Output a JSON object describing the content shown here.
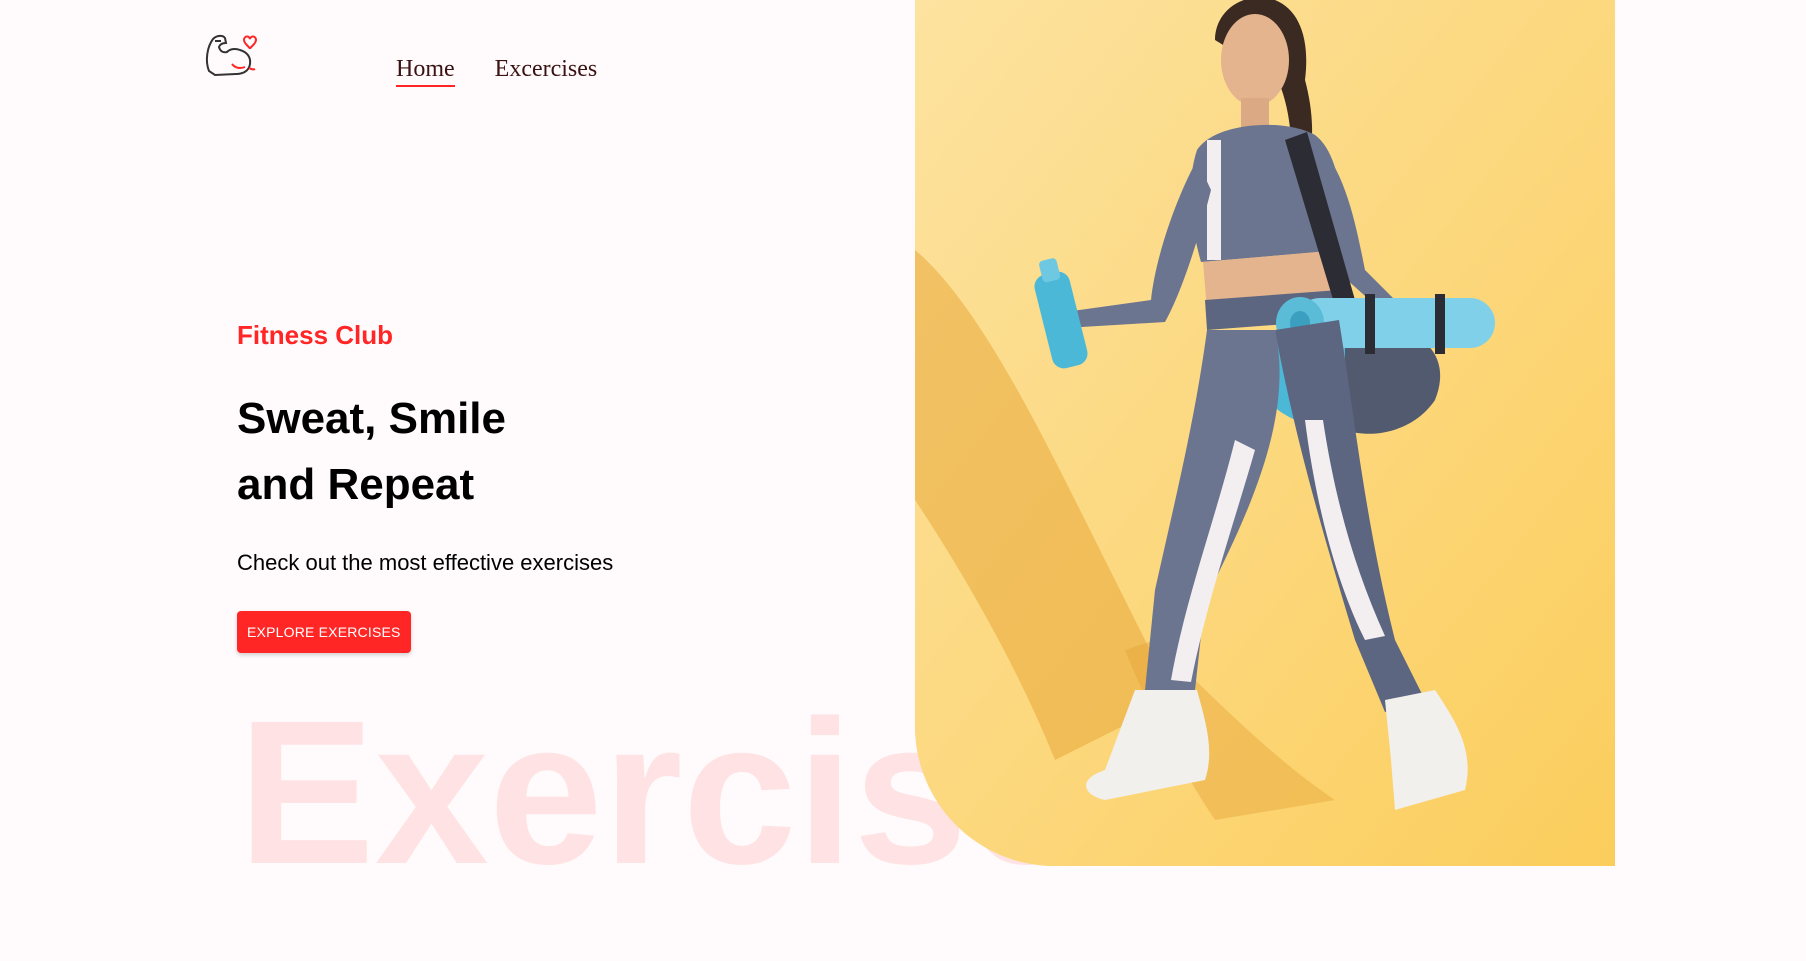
{
  "header": {
    "logo_icon": "flexed-arm-heart-icon",
    "nav": [
      {
        "label": "Home",
        "active": true
      },
      {
        "label": "Excercises",
        "active": false
      }
    ]
  },
  "hero": {
    "kicker": "Fitness Club",
    "headline_line1": "Sweat, Smile",
    "headline_line2": "and Repeat",
    "subtitle": "Check out the most effective exercises",
    "cta_label": "EXPLORE EXERCISES",
    "watermark": "Exercise",
    "banner_image": "woman-walking-with-gym-bag-and-yoga-mat"
  },
  "colors": {
    "accent": "#ff2625",
    "background": "#fffafb",
    "banner_bg": "#fcd56e",
    "text_dark": "#000000"
  }
}
